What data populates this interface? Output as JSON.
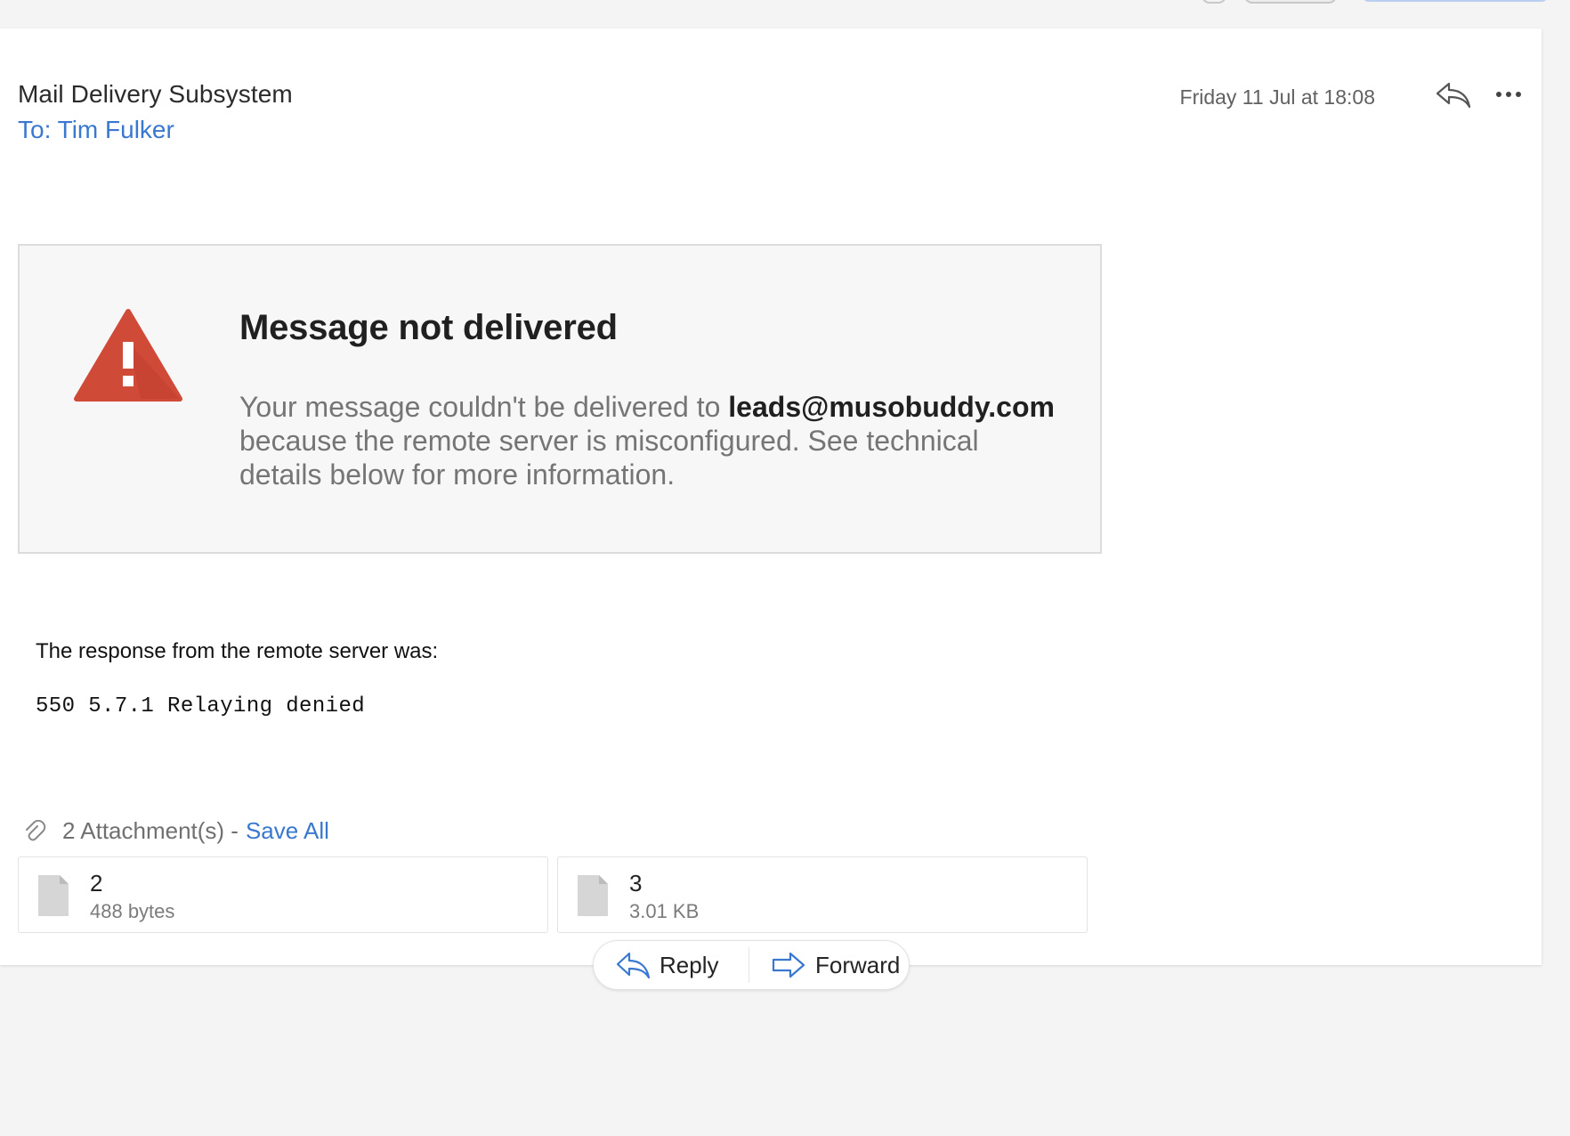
{
  "message": {
    "sender": "Mail Delivery Subsystem",
    "recipient": "To: Tim Fulker",
    "timestamp": "Friday 11 Jul at 18:08",
    "header_icons": [
      "reply-icon",
      "more-options-icon"
    ]
  },
  "ndr": {
    "title": "Message not delivered",
    "message_before": "Your message couldn't be delivered to ",
    "address": "leads@musobuddy.com",
    "message_after": " because the remote server is misconfigured. See technical details below for more information.",
    "warning_color": "#d04a38"
  },
  "response": {
    "label": "The response from the remote server was:",
    "code": "550 5.7.1 Relaying denied"
  },
  "attachments": {
    "header": "2 Attachment(s) -",
    "save_all": "Save All",
    "items": [
      {
        "name": "2",
        "size": "488 bytes"
      },
      {
        "name": "3",
        "size": "3.01 KB"
      }
    ]
  },
  "actions": {
    "reply": "Reply",
    "forward": "Forward"
  },
  "colors": {
    "accent": "#3a78d0",
    "background": "#f4f4f4",
    "card": "#ffffff"
  }
}
